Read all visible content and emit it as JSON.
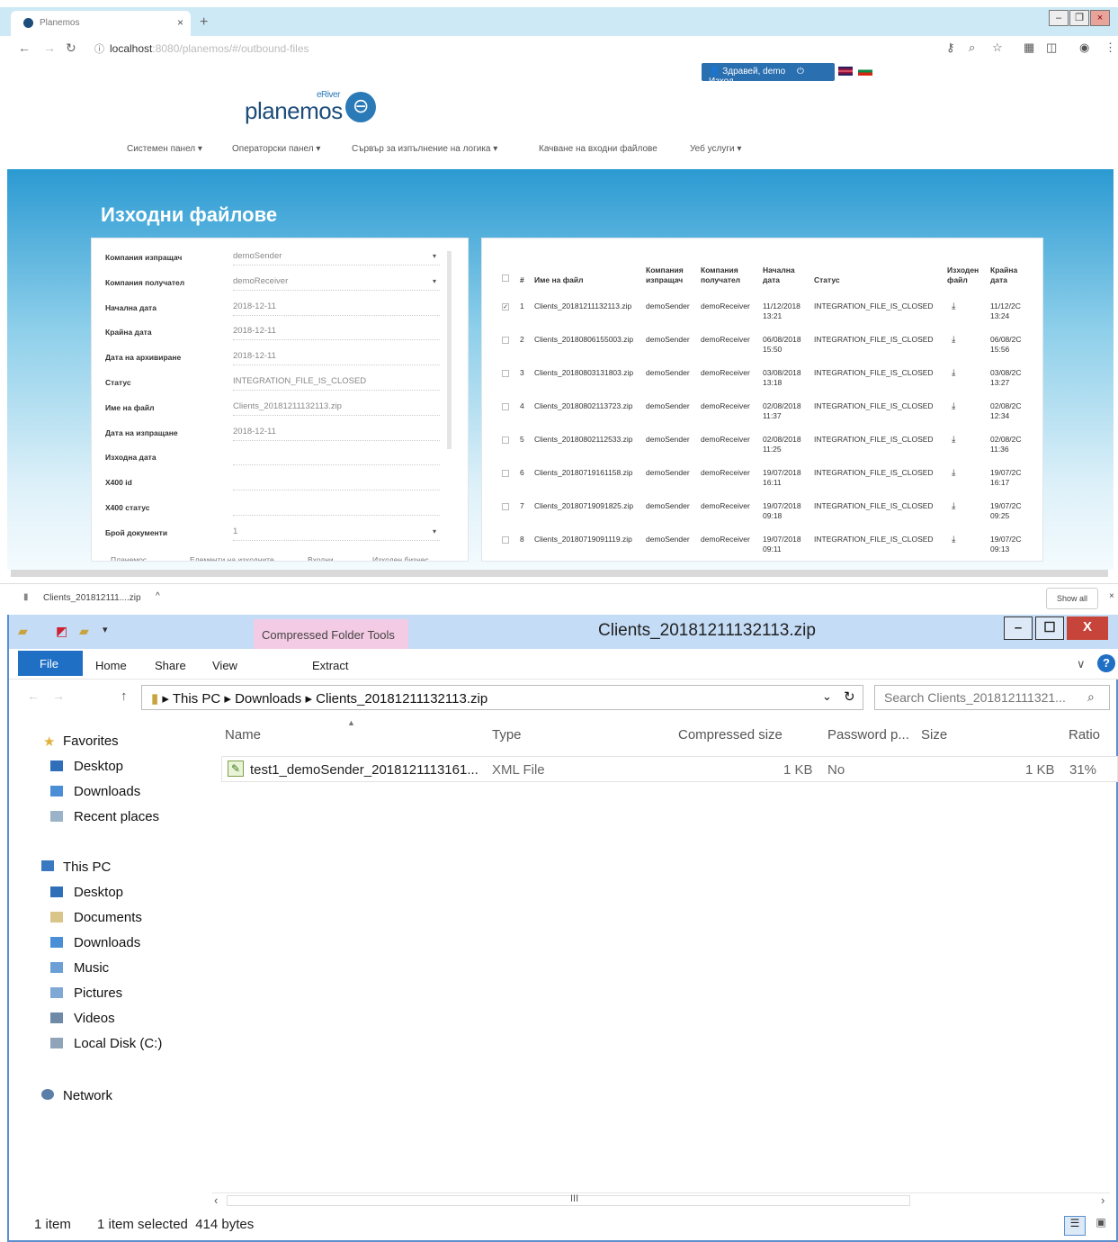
{
  "browser": {
    "tab_title": "Planemos",
    "address_host": "localhost",
    "address_rest": ":8080/planemos/#/outbound-files",
    "user_button": "Здравей, demo",
    "logout_button": "Изход",
    "logo_small": "eRiver",
    "logo_text": "planemos",
    "menu": [
      "Системен панел ▾",
      "Операторски панел ▾",
      "Сървър за изпълнение на логика ▾",
      "Качване на входни файлове",
      "Уеб услуги ▾"
    ],
    "page_title": "Изходни файлове",
    "form": [
      {
        "label": "Компания изпращач",
        "value": "demoSender"
      },
      {
        "label": "Компания получател",
        "value": "demoReceiver"
      },
      {
        "label": "Начална дата",
        "value": "2018-12-11"
      },
      {
        "label": "Крайна дата",
        "value": "2018-12-11"
      },
      {
        "label": "Дата на архивиране",
        "value": "2018-12-11"
      },
      {
        "label": "Статус",
        "value": "INTEGRATION_FILE_IS_CLOSED"
      },
      {
        "label": "Име на файл",
        "value": "Clients_20181211132113.zip"
      },
      {
        "label": "Дата на изпращане",
        "value": "2018-12-11"
      },
      {
        "label": "Изходна дата",
        "value": ""
      },
      {
        "label": "X400 id",
        "value": ""
      },
      {
        "label": "X400 статус",
        "value": ""
      },
      {
        "label": "Брой документи",
        "value": "1"
      }
    ],
    "form_tabs": [
      "Планемос",
      "Елементи на изходните",
      "Входни",
      "Изходен бизнес"
    ],
    "grid_headers": {
      "num": "#",
      "file_name": "Име на файл",
      "sender": "Компания\nизпращач",
      "receiver": "Компания\nполучател",
      "start_date": "Начална\nдата",
      "status": "Статус",
      "outfile": "Изходен\nфайл",
      "end_date": "Крайна\nдата"
    },
    "grid_rows": [
      {
        "num": "1",
        "file": "Clients_20181211132113.zip",
        "sender": "demoSender",
        "receiver": "demoReceiver",
        "start": "11/12/2018\n13:21",
        "status": "INTEGRATION_FILE_IS_CLOSED",
        "end": "11/12/2C\n13:24",
        "checked": true
      },
      {
        "num": "2",
        "file": "Clients_20180806155003.zip",
        "sender": "demoSender",
        "receiver": "demoReceiver",
        "start": "06/08/2018\n15:50",
        "status": "INTEGRATION_FILE_IS_CLOSED",
        "end": "06/08/2C\n15:56",
        "checked": false
      },
      {
        "num": "3",
        "file": "Clients_20180803131803.zip",
        "sender": "demoSender",
        "receiver": "demoReceiver",
        "start": "03/08/2018\n13:18",
        "status": "INTEGRATION_FILE_IS_CLOSED",
        "end": "03/08/2C\n13:27",
        "checked": false
      },
      {
        "num": "4",
        "file": "Clients_20180802113723.zip",
        "sender": "demoSender",
        "receiver": "demoReceiver",
        "start": "02/08/2018\n11:37",
        "status": "INTEGRATION_FILE_IS_CLOSED",
        "end": "02/08/2C\n12:34",
        "checked": false
      },
      {
        "num": "5",
        "file": "Clients_20180802112533.zip",
        "sender": "demoSender",
        "receiver": "demoReceiver",
        "start": "02/08/2018\n11:25",
        "status": "INTEGRATION_FILE_IS_CLOSED",
        "end": "02/08/2C\n11:36",
        "checked": false
      },
      {
        "num": "6",
        "file": "Clients_20180719161158.zip",
        "sender": "demoSender",
        "receiver": "demoReceiver",
        "start": "19/07/2018\n16:11",
        "status": "INTEGRATION_FILE_IS_CLOSED",
        "end": "19/07/2C\n16:17",
        "checked": false
      },
      {
        "num": "7",
        "file": "Clients_20180719091825.zip",
        "sender": "demoSender",
        "receiver": "demoReceiver",
        "start": "19/07/2018\n09:18",
        "status": "INTEGRATION_FILE_IS_CLOSED",
        "end": "19/07/2C\n09:25",
        "checked": false
      },
      {
        "num": "8",
        "file": "Clients_20180719091119.zip",
        "sender": "demoSender",
        "receiver": "demoReceiver",
        "start": "19/07/2018\n09:11",
        "status": "INTEGRATION_FILE_IS_CLOSED",
        "end": "19/07/2C\n09:13",
        "checked": false
      }
    ],
    "download_item": "Clients_201812111....zip",
    "show_all": "Show all"
  },
  "explorer": {
    "context_tab": "Compressed Folder Tools",
    "title": "Clients_20181211132113.zip",
    "ribbon_tabs": {
      "file": "File",
      "home": "Home",
      "share": "Share",
      "view": "View",
      "extract": "Extract"
    },
    "path": [
      "This PC",
      "Downloads",
      "Clients_20181211132113.zip"
    ],
    "search_placeholder": "Search Clients_201812111321...",
    "nav": {
      "favorites": "Favorites",
      "fav_items": [
        "Desktop",
        "Downloads",
        "Recent places"
      ],
      "this_pc": "This PC",
      "pc_items": [
        "Desktop",
        "Documents",
        "Downloads",
        "Music",
        "Pictures",
        "Videos",
        "Local Disk (C:)"
      ],
      "network": "Network"
    },
    "columns": {
      "name": "Name",
      "type": "Type",
      "compressed": "Compressed size",
      "password": "Password p...",
      "size": "Size",
      "ratio": "Ratio"
    },
    "file": {
      "name": "test1_demoSender_2018121113161...",
      "type": "XML File",
      "compressed": "1 KB",
      "password": "No",
      "size": "1 KB",
      "ratio": "31%"
    },
    "status": {
      "count": "1 item",
      "selected": "1 item selected  414 bytes"
    }
  },
  "colors": {
    "accent": "#1f6fc5",
    "brand": "#1d4d7a",
    "context_tab": "#f3cbe4"
  }
}
